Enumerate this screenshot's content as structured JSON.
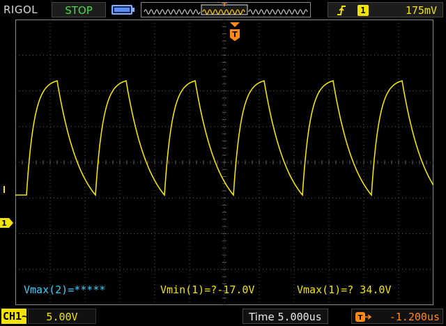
{
  "header": {
    "brand": "RIGOL",
    "run_status": "STOP",
    "battery_icon": "battery-icon",
    "trigger": {
      "edge_icon": "rising-edge-icon",
      "source": "1",
      "level": "175mV"
    }
  },
  "markers": {
    "trigger_position_label": "T",
    "ch1_ground_label": "1"
  },
  "measurements": {
    "vmax2": "Vmax(2)=*****",
    "vmin1": "Vmin(1)=?-17.0V",
    "vmax1": "Vmax(1)=? 34.0V"
  },
  "footer": {
    "ch1_tag": "CH1",
    "ch1_coupling": "~",
    "ch1_scale": "5.00V",
    "time_label": "Time",
    "time_value": "5.000us",
    "offset_value": "-1.200us"
  },
  "colors": {
    "trace": "#f2e300",
    "grid": "#5a5a5a",
    "status_run": "#3fe03f",
    "measurement_alt": "#36d0ff",
    "trigger": "#ff8a1a"
  }
}
